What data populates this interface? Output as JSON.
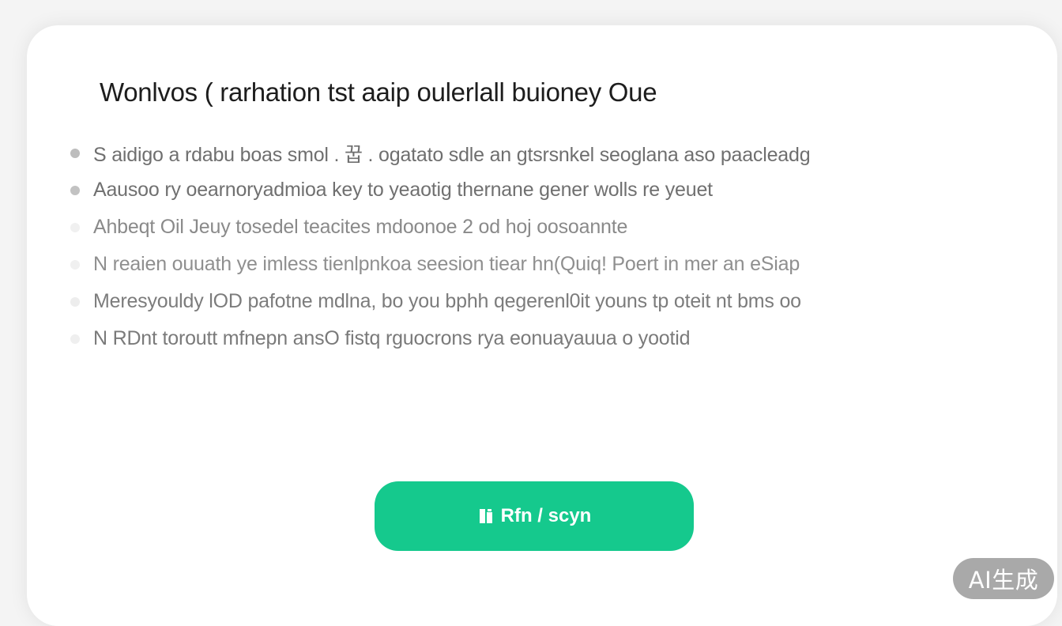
{
  "dialog": {
    "title": "Wonlvos ( rarhation tst aaip oulerlall buioney Oue",
    "bullets": [
      {
        "text": "S aidigo a rdabu boas smol . 꿉 . ogatato sdle an gtsrsnkel seoglana aso paacleadg",
        "dot_color": "#bdbdbd",
        "text_color": "#6f6f6f"
      },
      {
        "text": "Aausoo ry oearnoryadmioa key to yeaotig thernane gener wolls re yeuet",
        "dot_color": "#c2c2c2",
        "text_color": "#707070"
      },
      {
        "text": "Ahbeqt Oil Jeuy tosedel teacites mdoonoe 2 od hoj oosoannte",
        "dot_color": "#f0f0f0",
        "text_color": "#8a8a8a"
      },
      {
        "text": "N reaien ouuath ye imless tienlpnkoa seesion tiear hn(Quiq! Poert in mer an eSiap",
        "dot_color": "#f0f0f0",
        "text_color": "#8f8f8f"
      },
      {
        "text": "Meresyouldy lOD pafotne mdlna, bo you bphh qegerenl0it youns tp oteit nt bms oo",
        "dot_color": "#ededed",
        "text_color": "#7c7c7c"
      },
      {
        "text": "N RDnt toroutt mfnepn ansO fistq rguocrons rya eonuayauua o yootid",
        "dot_color": "#efefef",
        "text_color": "#7a7a7a"
      }
    ],
    "button_label": "Rfn / scyn",
    "button_icon": "document-icon"
  },
  "watermark": {
    "label": "AI生成"
  },
  "colors": {
    "accent": "#15c98d",
    "card_background": "#ffffff",
    "page_background": "#f4f4f4"
  }
}
